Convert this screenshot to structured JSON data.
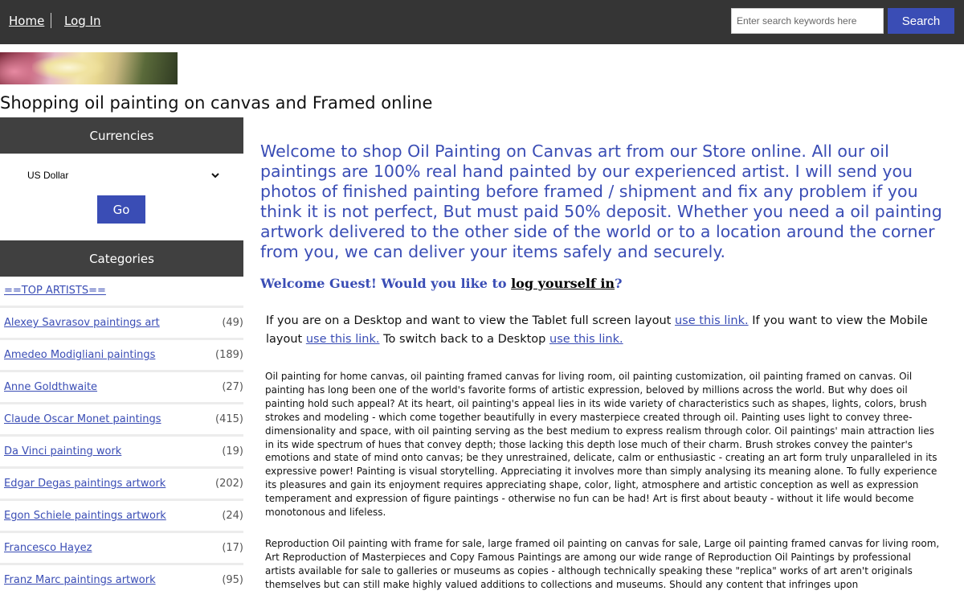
{
  "nav": {
    "home": "Home",
    "login": "Log In",
    "search_placeholder": "Enter search keywords here",
    "search_button": "Search"
  },
  "site_title": "Shopping oil painting on canvas and Framed online",
  "sidebar": {
    "currencies_heading": "Currencies",
    "currency_selected": "US Dollar",
    "go_button": "Go",
    "categories_heading": "Categories",
    "top_artists_link": "==TOP ARTISTS==",
    "categories": [
      {
        "name": "Alexey Savrasov paintings art",
        "count": "(49)"
      },
      {
        "name": "Amedeo Modigliani paintings",
        "count": "(189)"
      },
      {
        "name": "Anne Goldthwaite",
        "count": "(27)"
      },
      {
        "name": "Claude Oscar Monet paintings",
        "count": "(415)"
      },
      {
        "name": "Da Vinci painting work",
        "count": "(19)"
      },
      {
        "name": "Edgar Degas paintings artwork",
        "count": "(202)"
      },
      {
        "name": "Egon Schiele paintings artwork",
        "count": "(24)"
      },
      {
        "name": "Francesco Hayez",
        "count": "(17)"
      },
      {
        "name": "Franz Marc paintings artwork",
        "count": "(95)"
      }
    ]
  },
  "main": {
    "welcome": "Welcome to shop Oil Painting on Canvas art from our Store online. All our oil paintings are 100% real hand painted by our experienced artist. I will send you photos of finished painting before framed / shipment and fix any problem if you think it is not perfect, But must paid 50% deposit. Whether you need a oil painting artwork delivered to the other side of the world or to a location around the corner from you, we can deliver your items safely and securely.",
    "greeting_prefix": "Welcome Guest! Would you like to ",
    "greeting_link": "log yourself in",
    "greeting_suffix": "?",
    "layout_note_1": "If you are on a Desktop and want to view the Tablet full screen layout ",
    "layout_link_1": "use this link.",
    "layout_note_2": " If you want to view the Mobile layout ",
    "layout_link_2": "use this link.",
    "layout_note_3": " To switch back to a Desktop ",
    "layout_link_3": "use this link.",
    "paragraph_1": "Oil painting for home canvas, oil painting framed canvas for living room, oil painting customization, oil painting framed on canvas. Oil painting has long been one of the world's favorite forms of artistic expression, beloved by millions across the world. But why does oil painting hold such appeal? At its heart, oil painting's appeal lies in its wide variety of characteristics such as shapes, lights, colors, brush strokes and modeling - which come together beautifully in every masterpiece created through oil. Painting uses light to convey three-dimensionality and space, with oil painting serving as the best medium to express realism through color. Oil paintings' main attraction lies in its wide spectrum of hues that convey depth; those lacking this depth lose much of their charm. Brush strokes convey the painter's emotions and state of mind onto canvas; be they unrestrained, delicate, calm or enthusiastic - creating an art form truly unparalleled in its expressive power! Painting is visual storytelling. Appreciating it involves more than simply analysing its meaning alone. To fully experience its pleasures and gain its enjoyment requires appreciating shape, color, light, atmosphere and artistic conception as well as expression temperament and expression of figure paintings - otherwise no fun can be had! Art is first about beauty - without it life would become monotonous and lifeless.",
    "paragraph_2": "Reproduction Oil painting with frame for sale, large framed oil painting on canvas for sale, Large oil painting framed canvas for living room,  Art Reproduction of Masterpieces and Copy Famous Paintings are among our wide range of Reproduction Oil Paintings by professional artists available for sale to galleries or museums as copies - although technically speaking these \"replica\" works of art aren't originals themselves but can still make highly valued additions to collections and museums. Should any content that infringes upon"
  },
  "colors": {
    "topbar": "#353535",
    "accent": "#3a4db5",
    "sidebar_header": "#404040"
  }
}
